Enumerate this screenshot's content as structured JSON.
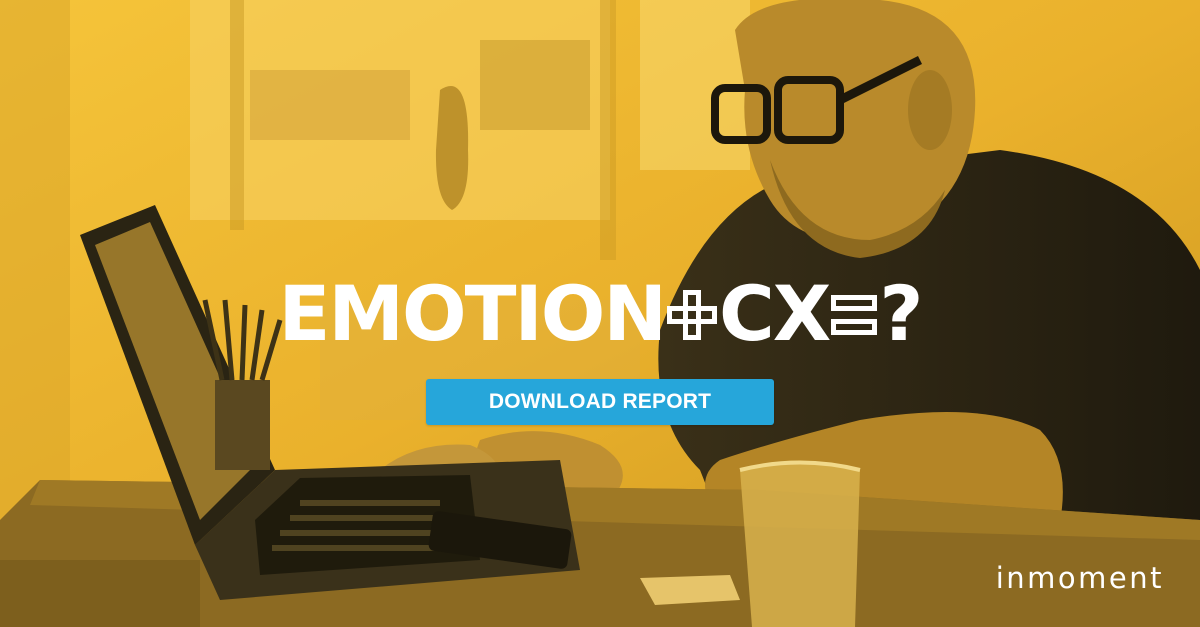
{
  "headline": {
    "word1": "EMOTION",
    "plus_icon": "plus-icon",
    "word2": "CX",
    "equals_icon": "equals-icon",
    "word3": "?"
  },
  "cta": {
    "label": "DOWNLOAD REPORT",
    "color": "#26a6da"
  },
  "brand": {
    "logo_text": "inmoment"
  },
  "colors": {
    "overlay": "#f0b72d",
    "shadow": "#2a2415",
    "text": "#ffffff"
  }
}
